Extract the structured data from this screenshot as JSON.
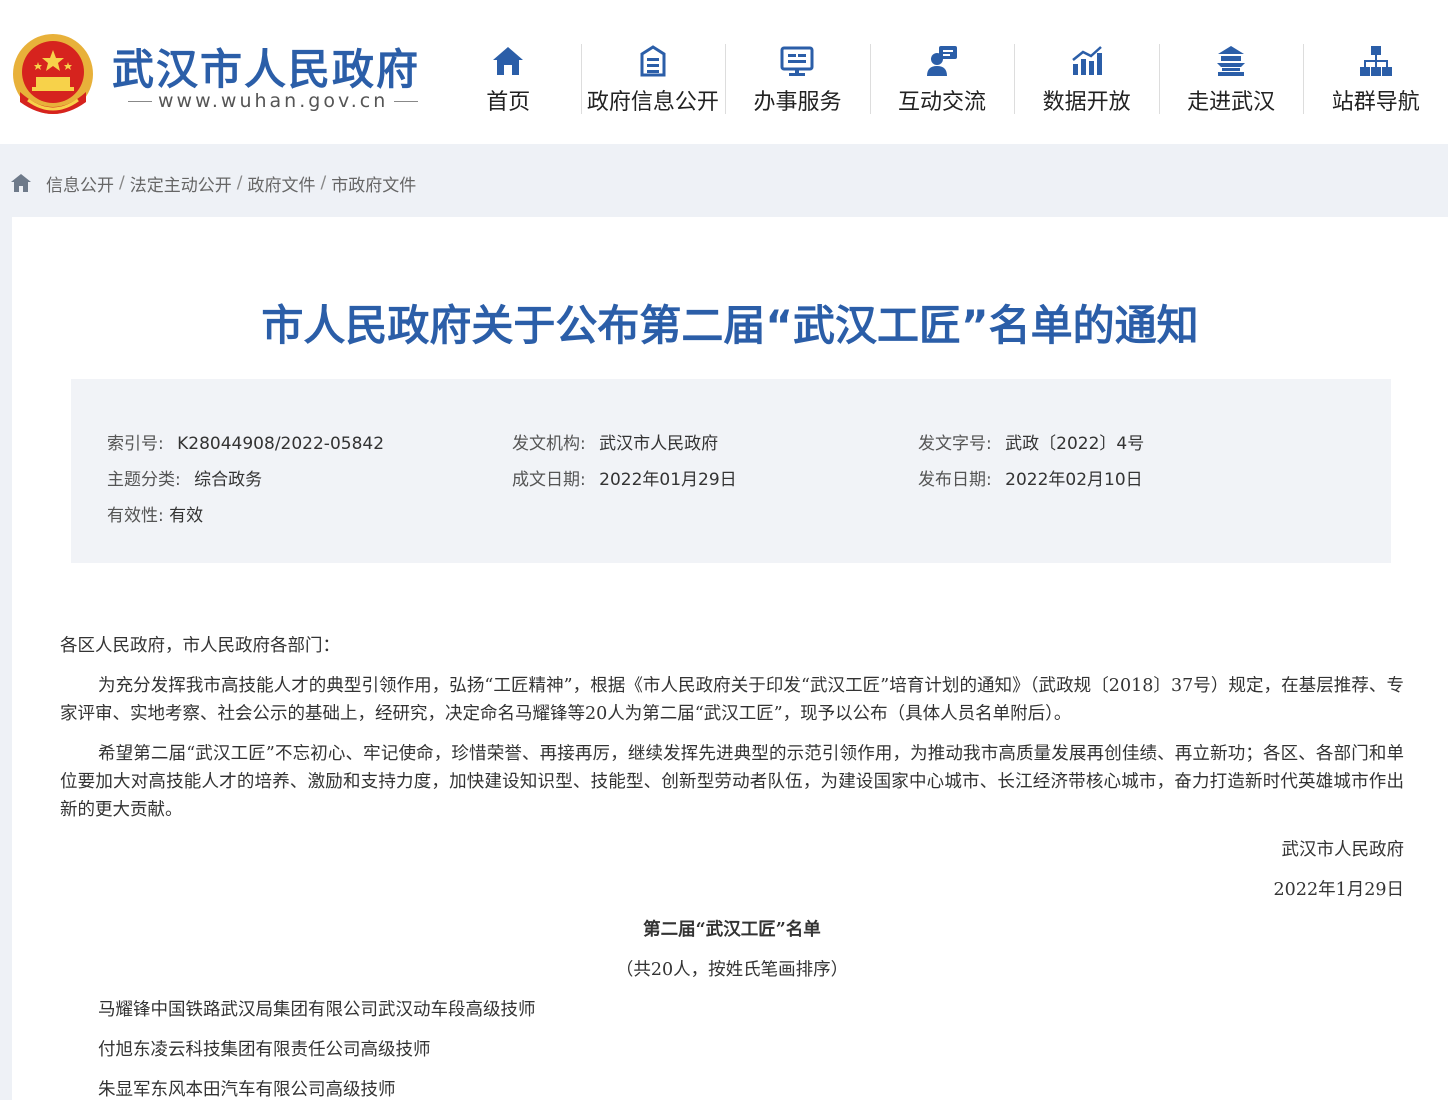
{
  "header": {
    "site_title": "武汉市人民政府",
    "site_url": "www.wuhan.gov.cn",
    "nav": [
      {
        "label": "首页",
        "icon": "home-icon"
      },
      {
        "label": "政府信息公开",
        "icon": "document-icon"
      },
      {
        "label": "办事服务",
        "icon": "monitor-icon"
      },
      {
        "label": "互动交流",
        "icon": "chat-icon"
      },
      {
        "label": "数据开放",
        "icon": "chart-icon"
      },
      {
        "label": "走进武汉",
        "icon": "pavilion-icon"
      },
      {
        "label": "站群导航",
        "icon": "sitemap-icon"
      }
    ]
  },
  "breadcrumb": [
    "信息公开",
    "法定主动公开",
    "政府文件",
    "市政府文件"
  ],
  "document": {
    "title": "市人民政府关于公布第二届“武汉工匠”名单的通知",
    "meta": {
      "index_label": "索引号:",
      "index_value": "K28044908/2022-05842",
      "issuer_label": "发文机构:",
      "issuer_value": "武汉市人民政府",
      "doc_no_label": "发文字号:",
      "doc_no_value": "武政〔2022〕4号",
      "category_label": "主题分类:",
      "category_value": "综合政务",
      "written_label": "成文日期:",
      "written_value": "2022年01月29日",
      "published_label": "发布日期:",
      "published_value": "2022年02月10日",
      "validity_label": "有效性:",
      "validity_value": "有效"
    },
    "salutation": "各区人民政府，市人民政府各部门：",
    "paragraph1": "为充分发挥我市高技能人才的典型引领作用，弘扬“工匠精神”，根据《市人民政府关于印发“武汉工匠”培育计划的通知》（武政规〔2018〕37号）规定，在基层推荐、专家评审、实地考察、社会公示的基础上，经研究，决定命名马耀锋等20人为第二届“武汉工匠”，现予以公布（具体人员名单附后）。",
    "paragraph2": "希望第二届“武汉工匠”不忘初心、牢记使命，珍惜荣誉、再接再厉，继续发挥先进典型的示范引领作用，为推动我市高质量发展再创佳绩、再立新功；各区、各部门和单位要加大对高技能人才的培养、激励和支持力度，加快建设知识型、技能型、创新型劳动者队伍，为建设国家中心城市、长江经济带核心城市，奋力打造新时代英雄城市作出新的更大贡献。",
    "signature": "武汉市人民政府",
    "date": "2022年1月29日",
    "list_title": "第二届“武汉工匠”名单",
    "list_subtitle": "（共20人，按姓氏笔画排序）",
    "list_items": [
      "马耀锋中国铁路武汉局集团有限公司武汉动车段高级技师",
      "付旭东凌云科技集团有限责任公司高级技师",
      "朱显军东风本田汽车有限公司高级技师"
    ]
  },
  "colors": {
    "brand_blue": "#2b5ea8",
    "band_bg": "#eef1f6",
    "meta_bg": "#f1f3f7"
  }
}
